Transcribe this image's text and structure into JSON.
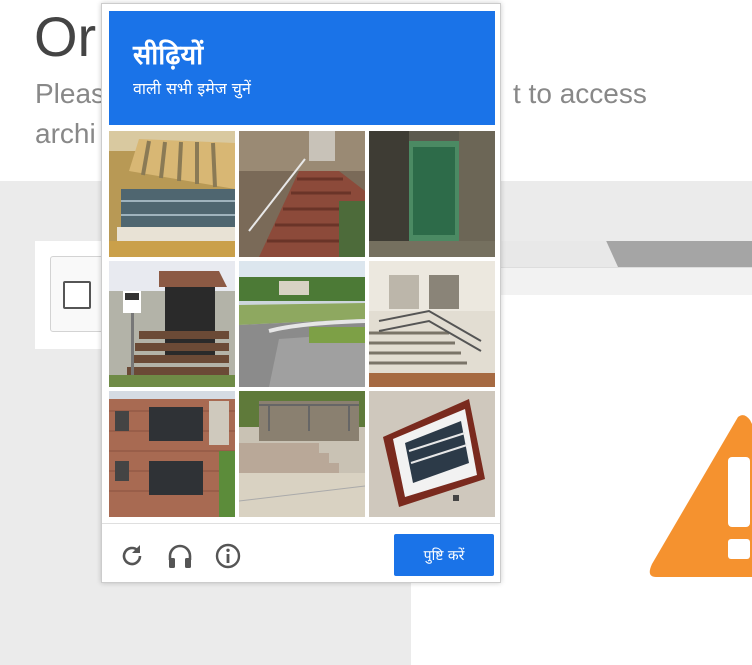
{
  "background": {
    "title": "Or",
    "subtitle_line1_left": "Pleas",
    "subtitle_line1_right": "t to access",
    "subtitle_line2": "archi"
  },
  "captcha": {
    "title": "सीढ़ियों",
    "subtitle": "वाली सभी इमेज चुनें",
    "tiles": [
      {
        "label": "balcony-awning"
      },
      {
        "label": "outdoor-stairs-brick"
      },
      {
        "label": "building-wall-green"
      },
      {
        "label": "wooden-porch-stairs-stop-sign"
      },
      {
        "label": "street-curb"
      },
      {
        "label": "concrete-stairs-railing"
      },
      {
        "label": "apartment-balconies"
      },
      {
        "label": "concrete-steps-railing"
      },
      {
        "label": "window-red-frame"
      }
    ],
    "verify_label": "पुष्टि करें",
    "icons": [
      "reload-icon",
      "headphones-icon",
      "info-icon"
    ]
  },
  "colors": {
    "accent": "#1a73e8",
    "warning": "#f5922f"
  }
}
